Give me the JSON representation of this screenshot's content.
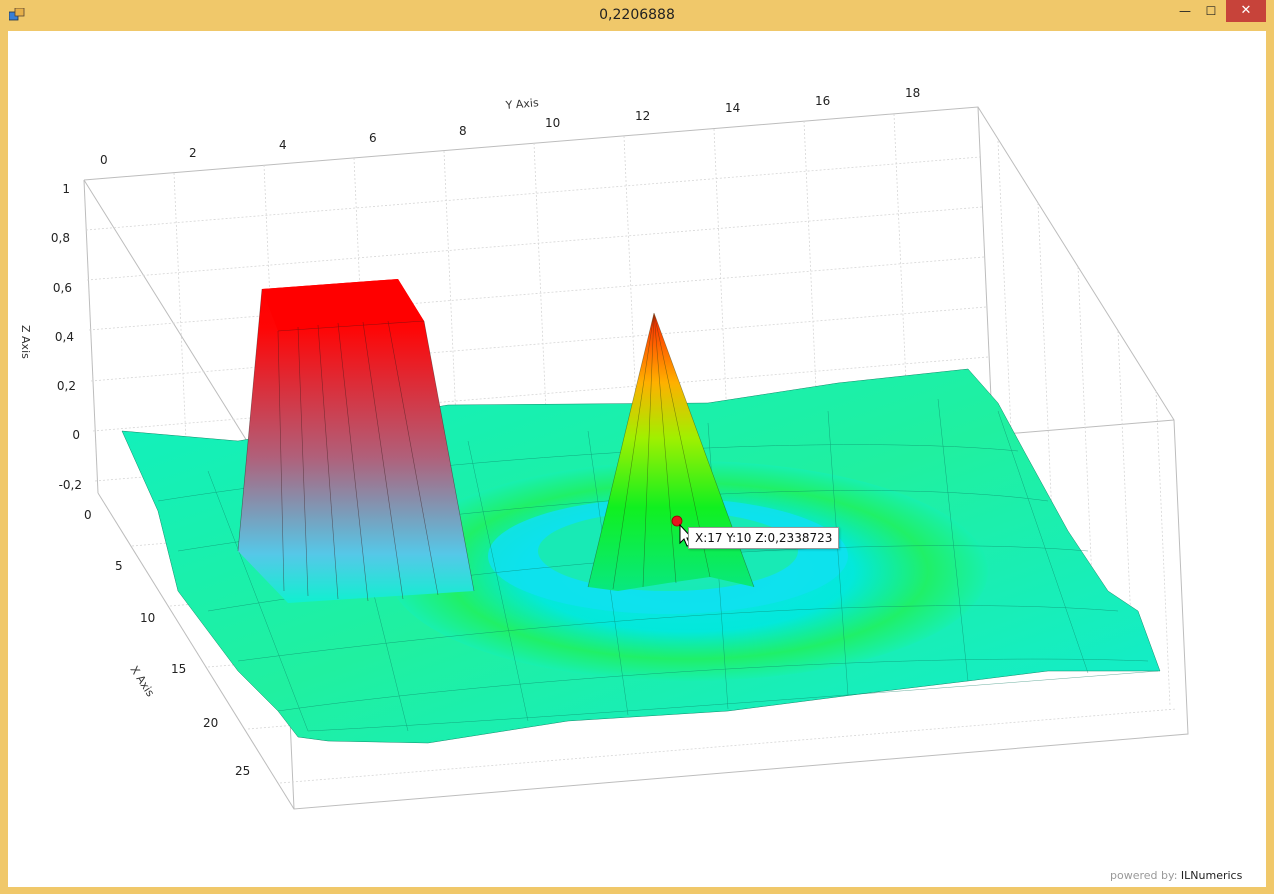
{
  "window": {
    "title": "0,2206888",
    "min_icon": "minimize-icon",
    "max_icon": "maximize-icon",
    "close_icon": "close-icon",
    "min_glyph": "—",
    "max_glyph": "☐",
    "close_glyph": "✕"
  },
  "plot": {
    "y_axis_title": "Y Axis",
    "x_axis_title": "X Axis",
    "z_axis_title": "Z Axis",
    "y_ticks": [
      "0",
      "2",
      "4",
      "6",
      "8",
      "10",
      "12",
      "14",
      "16",
      "18"
    ],
    "x_ticks": [
      "0",
      "5",
      "10",
      "15",
      "20",
      "25"
    ],
    "z_ticks": [
      "1",
      "0,8",
      "0,6",
      "0,4",
      "0,2",
      "0",
      "-0,2"
    ],
    "tooltip": "X:17 Y:10 Z:0,2338723",
    "powered_by_prefix": "powered by:",
    "powered_by_brand": "ILNumerics",
    "colors": {
      "high": "#ff0000",
      "mid": "#00ff33",
      "low": "#00e8e0",
      "marker": "#e8141e"
    }
  },
  "chart_data": {
    "type": "surface",
    "xlabel": "X Axis",
    "ylabel": "Y Axis",
    "zlabel": "Z Axis",
    "xlim": [
      0,
      27
    ],
    "ylim": [
      0,
      19
    ],
    "zlim": [
      -0.2,
      1
    ],
    "highlighted_point": {
      "x": 17,
      "y": 10,
      "z": 0.2338723
    },
    "features": [
      "flat plateau at z≈0.6 near low X/Y",
      "conical peak at z≈0.5 near X≈17 Y≈10",
      "ring-shaped ripple around peak",
      "near-zero base surface"
    ]
  }
}
